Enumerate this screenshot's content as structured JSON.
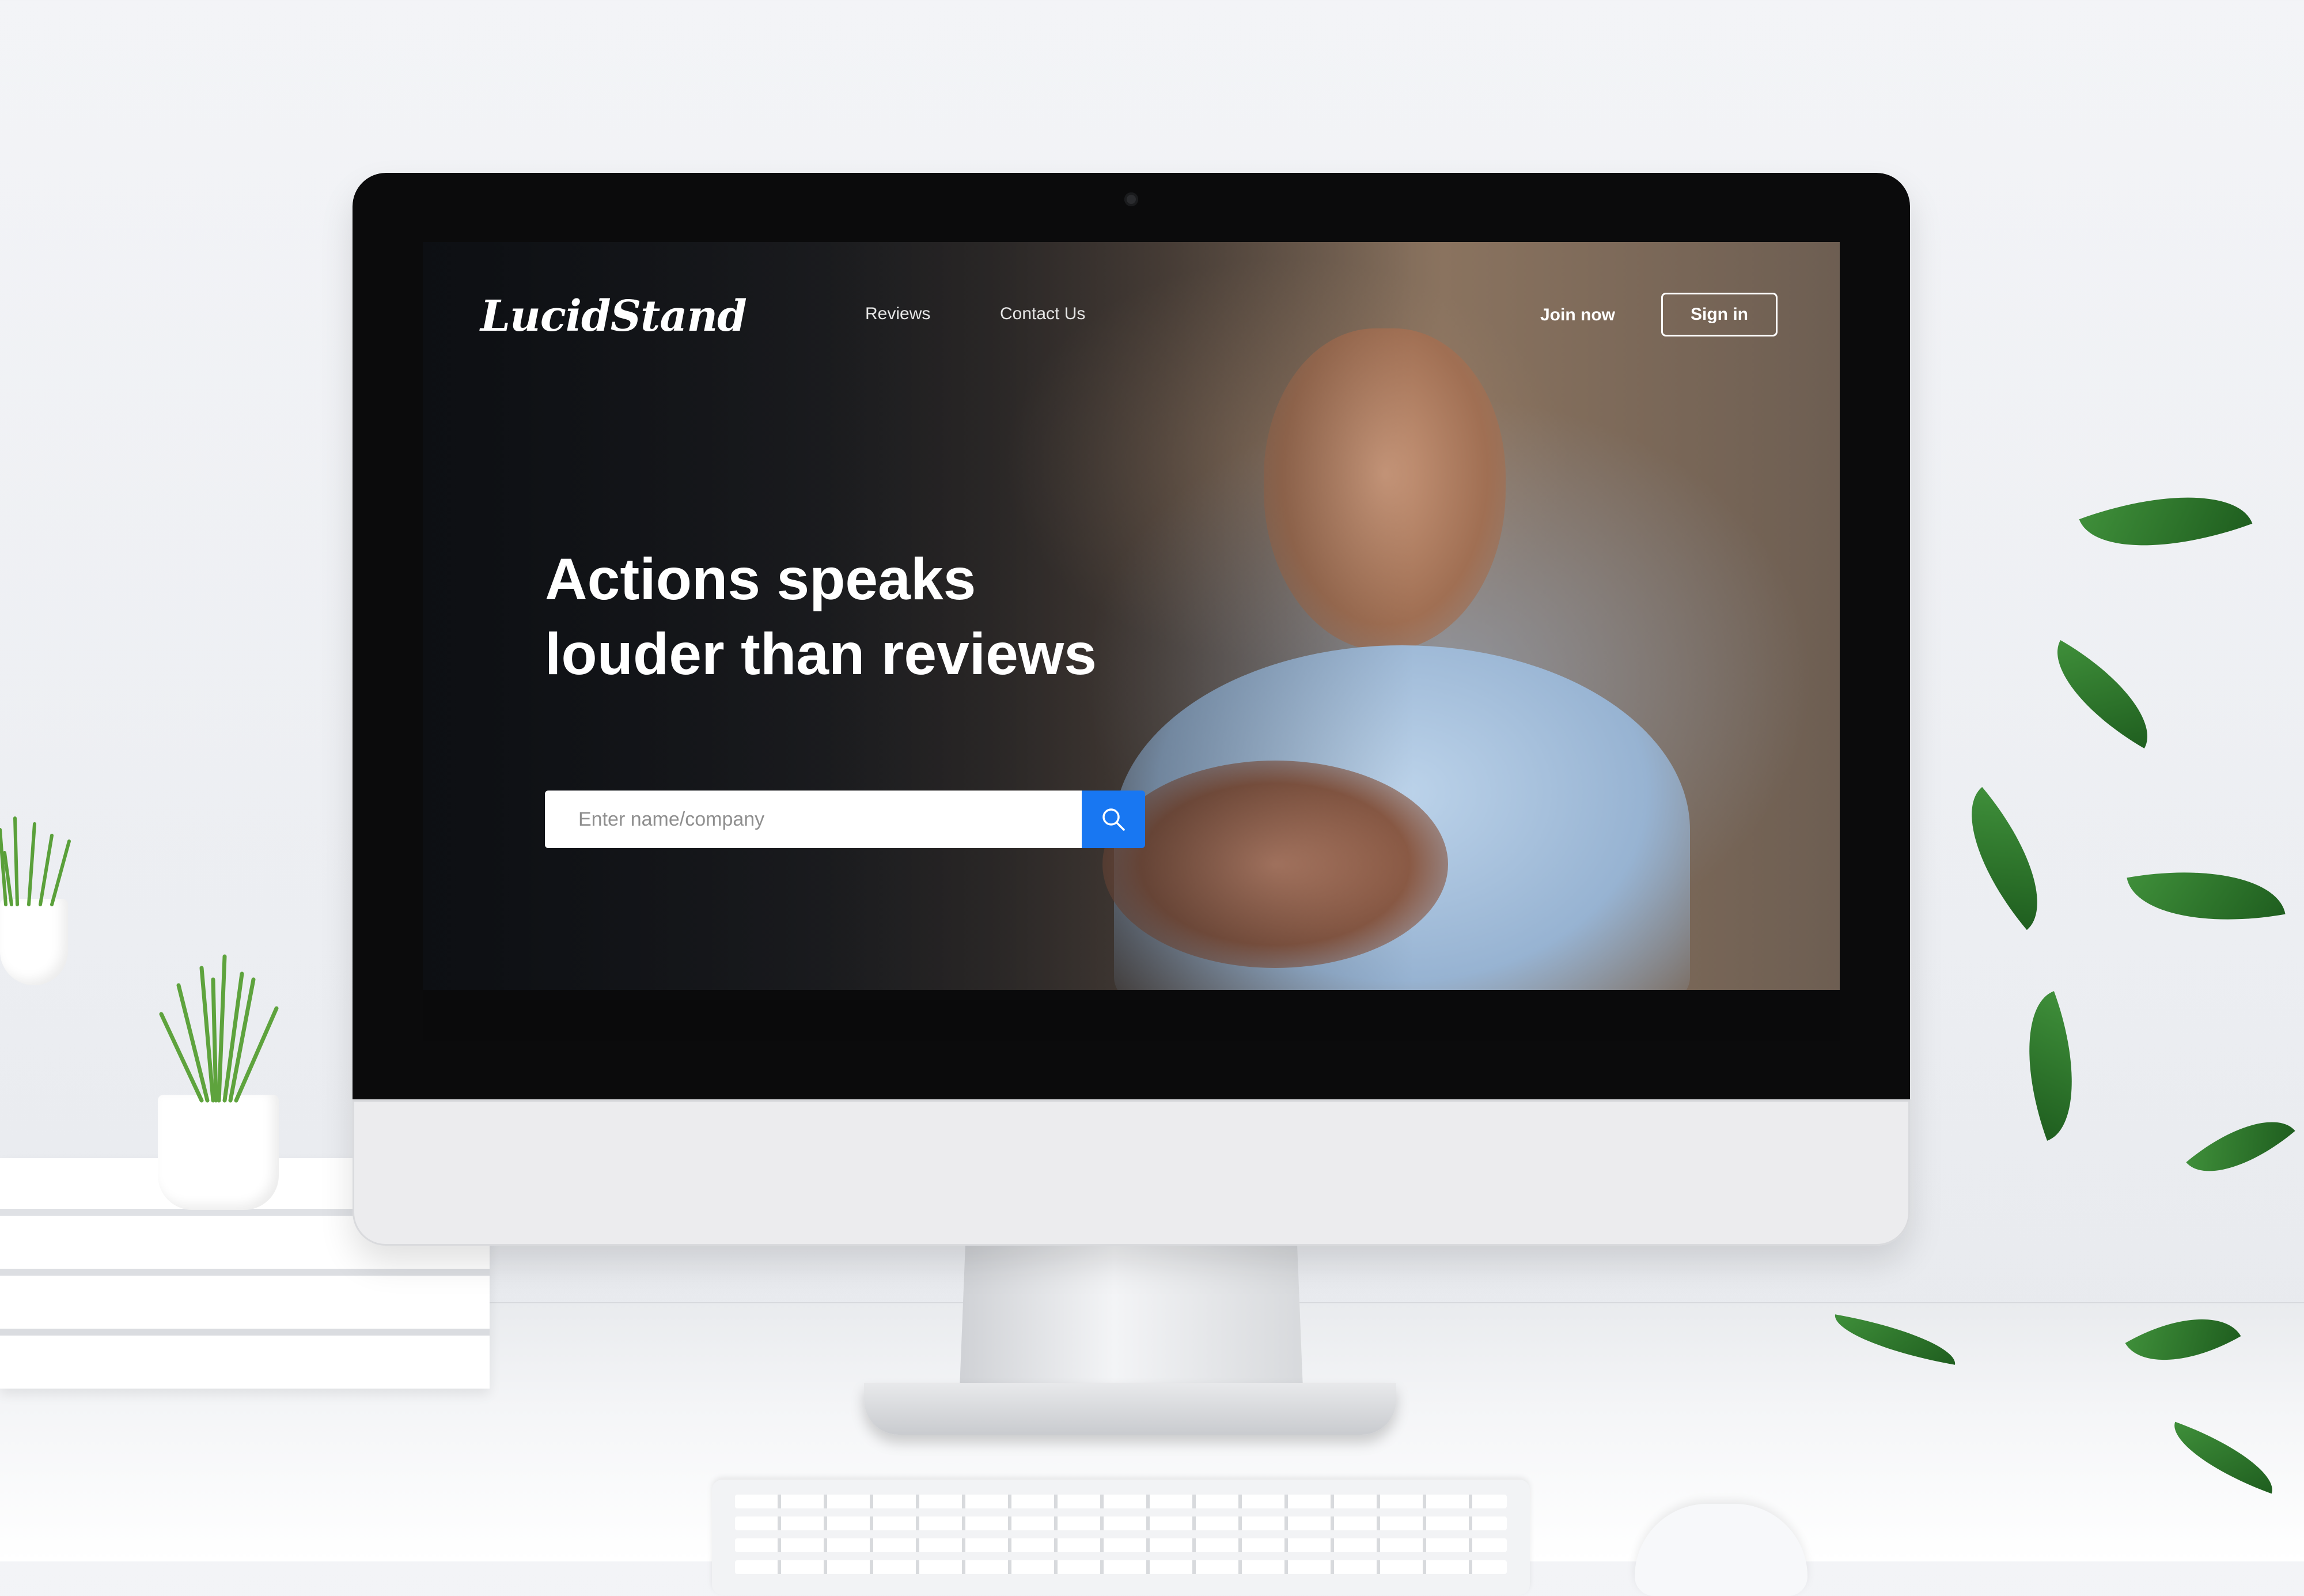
{
  "site": {
    "logo_text": "LucidStand",
    "nav": {
      "reviews_label": "Reviews",
      "contact_label": "Contact Us",
      "join_label": "Join now",
      "signin_label": "Sign in"
    },
    "hero": {
      "headline_line1": "Actions speaks",
      "headline_line2": "louder than reviews"
    },
    "search": {
      "placeholder": "Enter name/company",
      "icon": "search-icon"
    }
  },
  "colors": {
    "accent": "#1877f2",
    "text_on_hero": "#ffffff"
  }
}
